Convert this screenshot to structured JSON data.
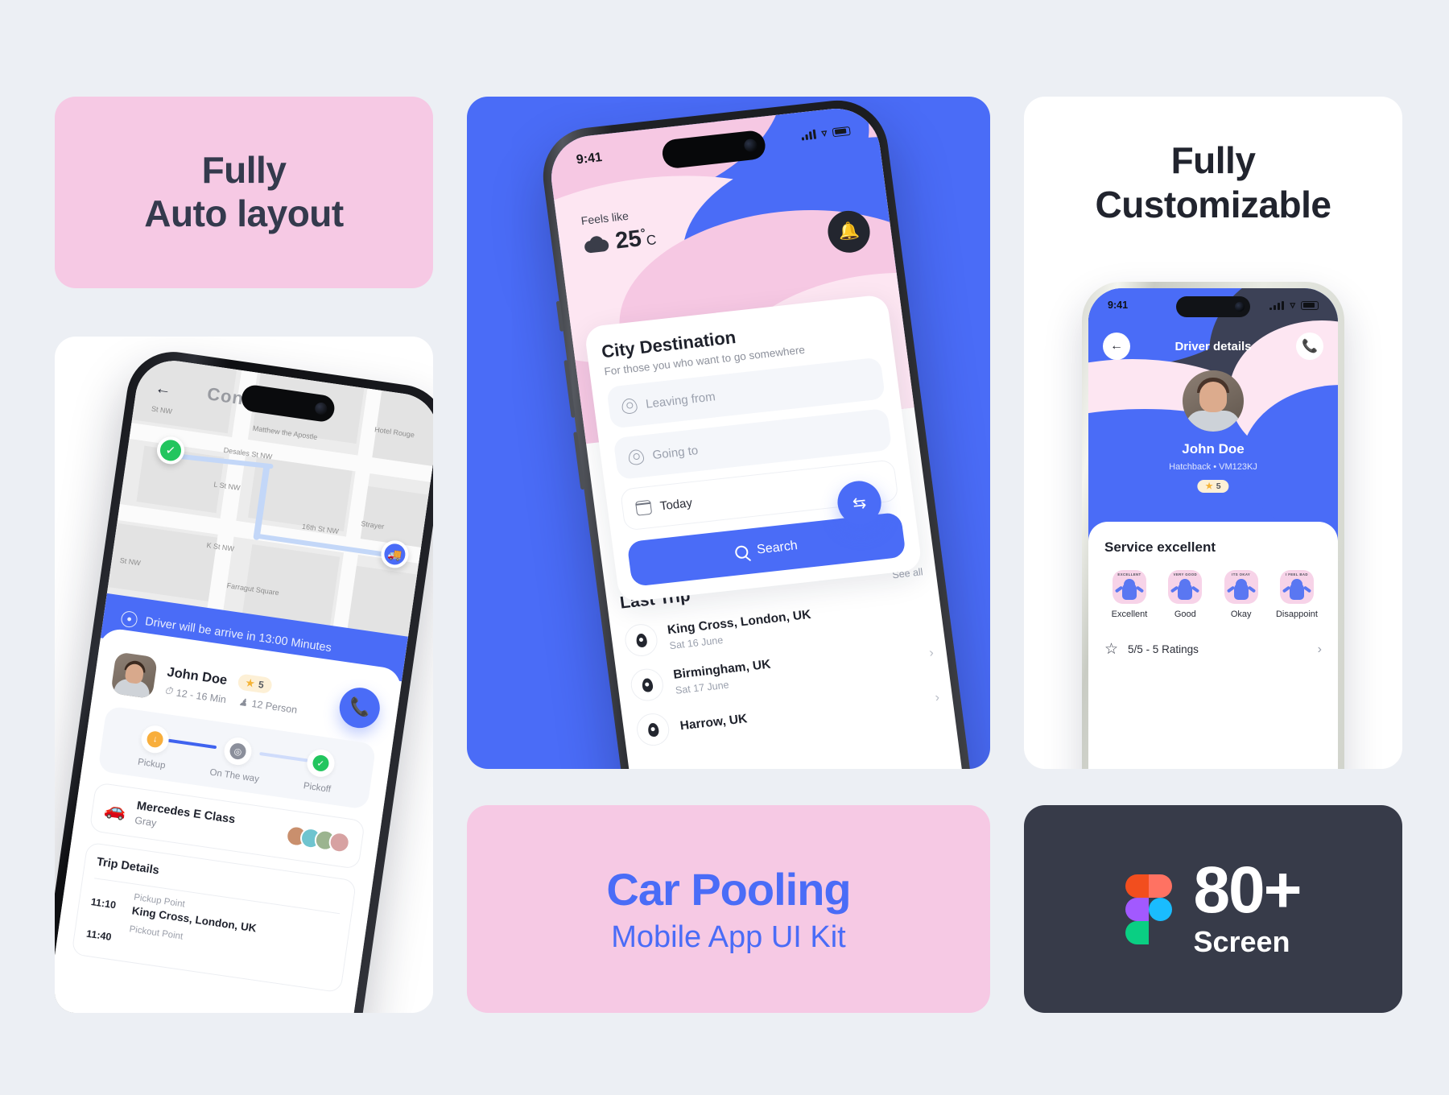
{
  "theme": {
    "page_bg": "#eceff4",
    "brand_blue": "#4a6cf7",
    "pink": "#f6c9e4",
    "light_pink": "#fde6f2",
    "dark": "#373b49"
  },
  "card_autolayout": {
    "line1": "Fully",
    "line2": "Auto layout"
  },
  "card_customizable": {
    "line1": "Fully",
    "line2": "Customizable"
  },
  "card_carpool": {
    "title": "Car Pooling",
    "subtitle": "Mobile App UI Kit"
  },
  "card_screens": {
    "count": "80+",
    "label": "Screen",
    "logo": "figma-logo-icon"
  },
  "left_phone": {
    "map": {
      "title": "Consizst",
      "back_icon": "back-arrow-icon",
      "start_marker": "start-pin-icon",
      "car_marker": "car-pin-icon",
      "street_labels": [
        "St NW",
        "Hotel Rouge",
        "Matthew the Apostle",
        "Desales St NW",
        "L St NW",
        "K St NW",
        "16th St NW",
        "Strayer",
        "St NW",
        "Farragut Square"
      ]
    },
    "arrive_banner": {
      "icon": "user-circle-icon",
      "text": "Driver will be arrive in 13:00 Minutes"
    },
    "driver": {
      "avatar": "driver-avatar",
      "name": "John Doe",
      "rating": "5",
      "star_icon": "star-icon",
      "duration_icon": "clock-icon",
      "duration": "12 - 16 Min",
      "persons_icon": "person-icon",
      "persons": "12 Person",
      "call_icon": "phone-icon"
    },
    "steps": [
      {
        "label": "Pickup",
        "icon": "arrow-down-icon",
        "state": "done"
      },
      {
        "label": "On The way",
        "icon": "circle-dot-icon",
        "state": "active"
      },
      {
        "label": "Pickoff",
        "icon": "check-icon",
        "state": "pending"
      }
    ],
    "car": {
      "icon": "car-icon",
      "name": "Mercedes E Class",
      "color": "Gray",
      "passengers": 4
    },
    "trip_details": {
      "title": "Trip Details",
      "rows": [
        {
          "time": "11:10",
          "kind": "Pickup Point",
          "place": "King Cross, London, UK"
        },
        {
          "time": "11:40",
          "kind": "Pickout Point",
          "place": ""
        }
      ]
    }
  },
  "center_phone": {
    "status_bar": {
      "time": "9:41",
      "signal_icon": "cellular-icon",
      "wifi_icon": "wifi-icon",
      "battery_icon": "battery-icon"
    },
    "weather": {
      "label": "Feels like",
      "icon": "cloud-icon",
      "temperature": "25",
      "degree": "°",
      "unit": "C"
    },
    "notification_icon": "bell-icon",
    "search_card": {
      "title": "City Destination",
      "subtitle": "For those you who want to go somewhere",
      "leaving_from_icon": "location-pin-icon",
      "leaving_from_placeholder": "Leaving from",
      "going_to_icon": "location-pin-icon",
      "going_to_placeholder": "Going to",
      "swap_icon": "swap-icon",
      "date_icon": "calendar-icon",
      "date_value": "Today",
      "search_icon": "search-icon",
      "search_label": "Search"
    },
    "last_trip": {
      "title": "Last Trip",
      "see_all": "See all",
      "items": [
        {
          "icon": "map-pin-icon",
          "place": "King Cross, London, UK",
          "date": "Sat 16 June",
          "chevron": "chevron-right-icon"
        },
        {
          "icon": "map-pin-icon",
          "place": "Birmingham, UK",
          "date": "Sat 17 June",
          "chevron": "chevron-right-icon"
        },
        {
          "icon": "map-pin-icon",
          "place": "Harrow, UK",
          "date": "",
          "chevron": "chevron-right-icon"
        }
      ]
    }
  },
  "right_phone": {
    "status_bar": {
      "time": "9:41",
      "signal_icon": "cellular-icon",
      "wifi_icon": "wifi-icon",
      "battery_icon": "battery-icon"
    },
    "header": {
      "back_icon": "back-arrow-icon",
      "title": "Driver details",
      "call_icon": "phone-icon"
    },
    "driver": {
      "avatar": "driver-avatar",
      "name": "John Doe",
      "car_type": "Hatchback",
      "separator": "•",
      "plate": "VM123KJ",
      "star_icon": "star-icon",
      "rating": "5"
    },
    "service": {
      "title": "Service excellent",
      "options": [
        {
          "label": "Excellent",
          "caption": "EXCELLENT",
          "icon": "excellent-emoji-icon"
        },
        {
          "label": "Good",
          "caption": "VERY GOOD",
          "icon": "good-emoji-icon"
        },
        {
          "label": "Okay",
          "caption": "ITS OKAY",
          "icon": "okay-emoji-icon"
        },
        {
          "label": "Disappoint",
          "caption": "I FEEL BAD",
          "icon": "disappoint-emoji-icon"
        }
      ],
      "rating_star_icon": "star-outline-icon",
      "rating_text": "5/5 - 5 Ratings",
      "rating_chevron": "chevron-right-icon"
    }
  }
}
